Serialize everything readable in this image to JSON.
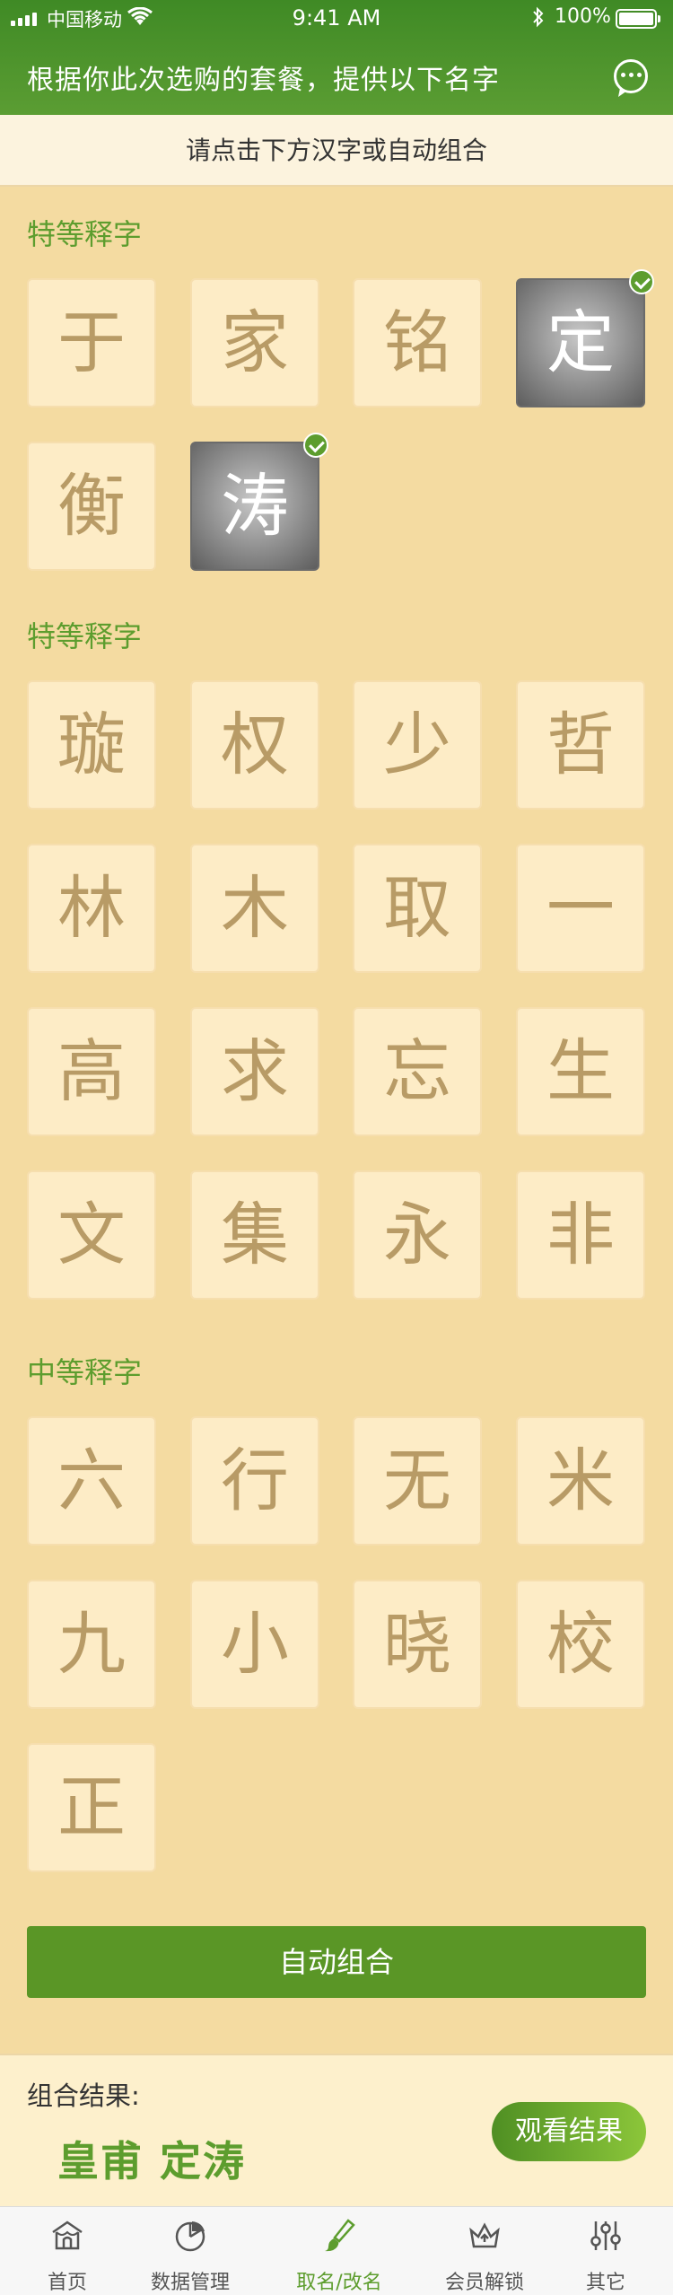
{
  "status_bar": {
    "carrier": "中国移动",
    "time": "9:41 AM",
    "battery": "100%"
  },
  "header": {
    "title": "根据你此次选购的套餐，提供以下名字"
  },
  "instruction": "请点击下方汉字或自动组合",
  "sections": [
    {
      "title": "特等释字",
      "chars": [
        {
          "char": "于",
          "selected": false
        },
        {
          "char": "家",
          "selected": false
        },
        {
          "char": "铭",
          "selected": false
        },
        {
          "char": "定",
          "selected": true
        },
        {
          "char": "衡",
          "selected": false
        },
        {
          "char": "涛",
          "selected": true
        }
      ]
    },
    {
      "title": "特等释字",
      "chars": [
        {
          "char": "璇",
          "selected": false
        },
        {
          "char": "权",
          "selected": false
        },
        {
          "char": "少",
          "selected": false
        },
        {
          "char": "哲",
          "selected": false
        },
        {
          "char": "林",
          "selected": false
        },
        {
          "char": "木",
          "selected": false
        },
        {
          "char": "取",
          "selected": false
        },
        {
          "char": "一",
          "selected": false
        },
        {
          "char": "高",
          "selected": false
        },
        {
          "char": "求",
          "selected": false
        },
        {
          "char": "忘",
          "selected": false
        },
        {
          "char": "生",
          "selected": false
        },
        {
          "char": "文",
          "selected": false
        },
        {
          "char": "集",
          "selected": false
        },
        {
          "char": "永",
          "selected": false
        },
        {
          "char": "非",
          "selected": false
        }
      ]
    },
    {
      "title": "中等释字",
      "chars": [
        {
          "char": "六",
          "selected": false
        },
        {
          "char": "行",
          "selected": false
        },
        {
          "char": "无",
          "selected": false
        },
        {
          "char": "米",
          "selected": false
        },
        {
          "char": "九",
          "selected": false
        },
        {
          "char": "小",
          "selected": false
        },
        {
          "char": "晓",
          "selected": false
        },
        {
          "char": "校",
          "selected": false
        },
        {
          "char": "正",
          "selected": false
        }
      ]
    }
  ],
  "auto_button": "自动组合",
  "result": {
    "label": "组合结果:",
    "name": "皇甫 定涛",
    "view_button": "观看结果"
  },
  "tabs": [
    {
      "label": "首页",
      "icon": "home-icon",
      "active": false
    },
    {
      "label": "数据管理",
      "icon": "pie-chart-icon",
      "active": false
    },
    {
      "label": "取名/改名",
      "icon": "brush-icon",
      "active": true
    },
    {
      "label": "会员解锁",
      "icon": "crown-icon",
      "active": false
    },
    {
      "label": "其它",
      "icon": "sliders-icon",
      "active": false
    }
  ],
  "colors": {
    "accent": "#5d9d2e",
    "header": "#4a8f2a",
    "background": "#f4dba1",
    "tile": "#fdecc6",
    "tile_text": "#b89b66"
  }
}
